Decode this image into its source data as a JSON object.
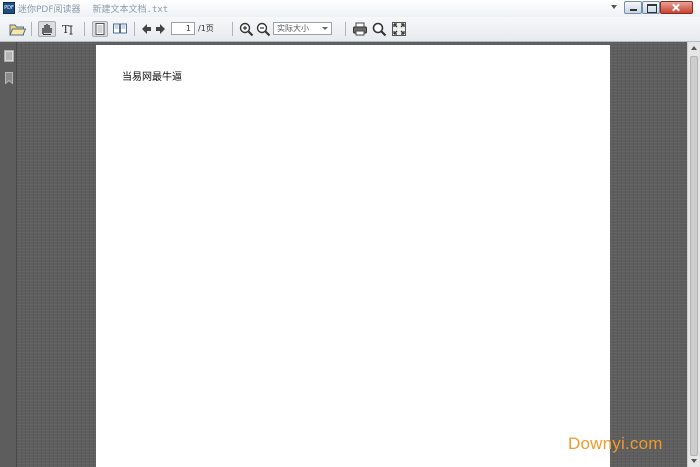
{
  "titlebar": {
    "app_title": "迷你PDF阅读器",
    "file_name": "新建文本文档.txt",
    "app_icon_text": "PDF"
  },
  "toolbar": {
    "page_number": "1",
    "page_total": "/1页",
    "zoom_value": "实际大小"
  },
  "document": {
    "text": "当易网最牛逼"
  },
  "watermark": "Downyi.com",
  "colors": {
    "viewer_bg": "#5e5e5e",
    "page_bg": "#ffffff",
    "watermark": "#f09a2c",
    "accent": "#1d4f86"
  }
}
